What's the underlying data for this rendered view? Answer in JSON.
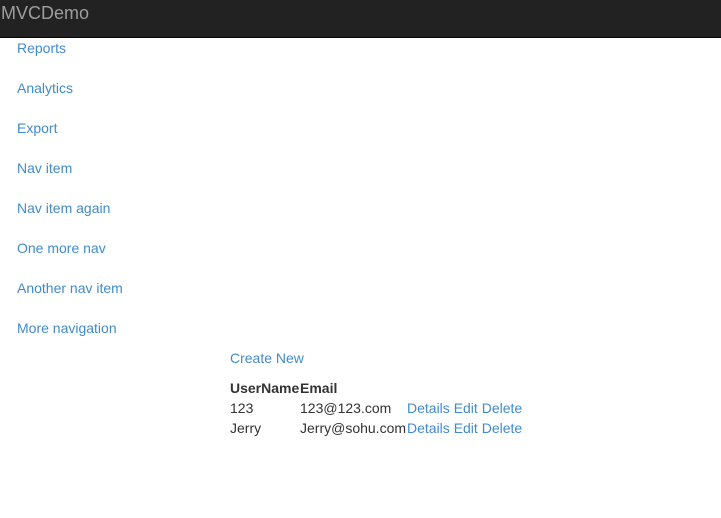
{
  "navbar": {
    "brand": "MVCDemo"
  },
  "sidebar": {
    "items": [
      {
        "label": "Reports"
      },
      {
        "label": "Analytics"
      },
      {
        "label": "Export"
      },
      {
        "label": "Nav item"
      },
      {
        "label": "Nav item again"
      },
      {
        "label": "One more nav"
      },
      {
        "label": "Another nav item"
      },
      {
        "label": "More navigation"
      }
    ]
  },
  "main": {
    "create_new": "Create New",
    "table": {
      "headers": [
        "UserName",
        "Email",
        ""
      ],
      "rows": [
        {
          "username": "123",
          "email": "123@123.com",
          "actions": [
            "Details",
            "Edit",
            "Delete"
          ]
        },
        {
          "username": "Jerry",
          "email": "Jerry@sohu.com",
          "actions": [
            "Details",
            "Edit",
            "Delete"
          ]
        }
      ]
    }
  },
  "colors": {
    "navbar_bg": "#222222",
    "brand": "#9d9d9d",
    "link": "#428bca",
    "text": "#333333"
  }
}
